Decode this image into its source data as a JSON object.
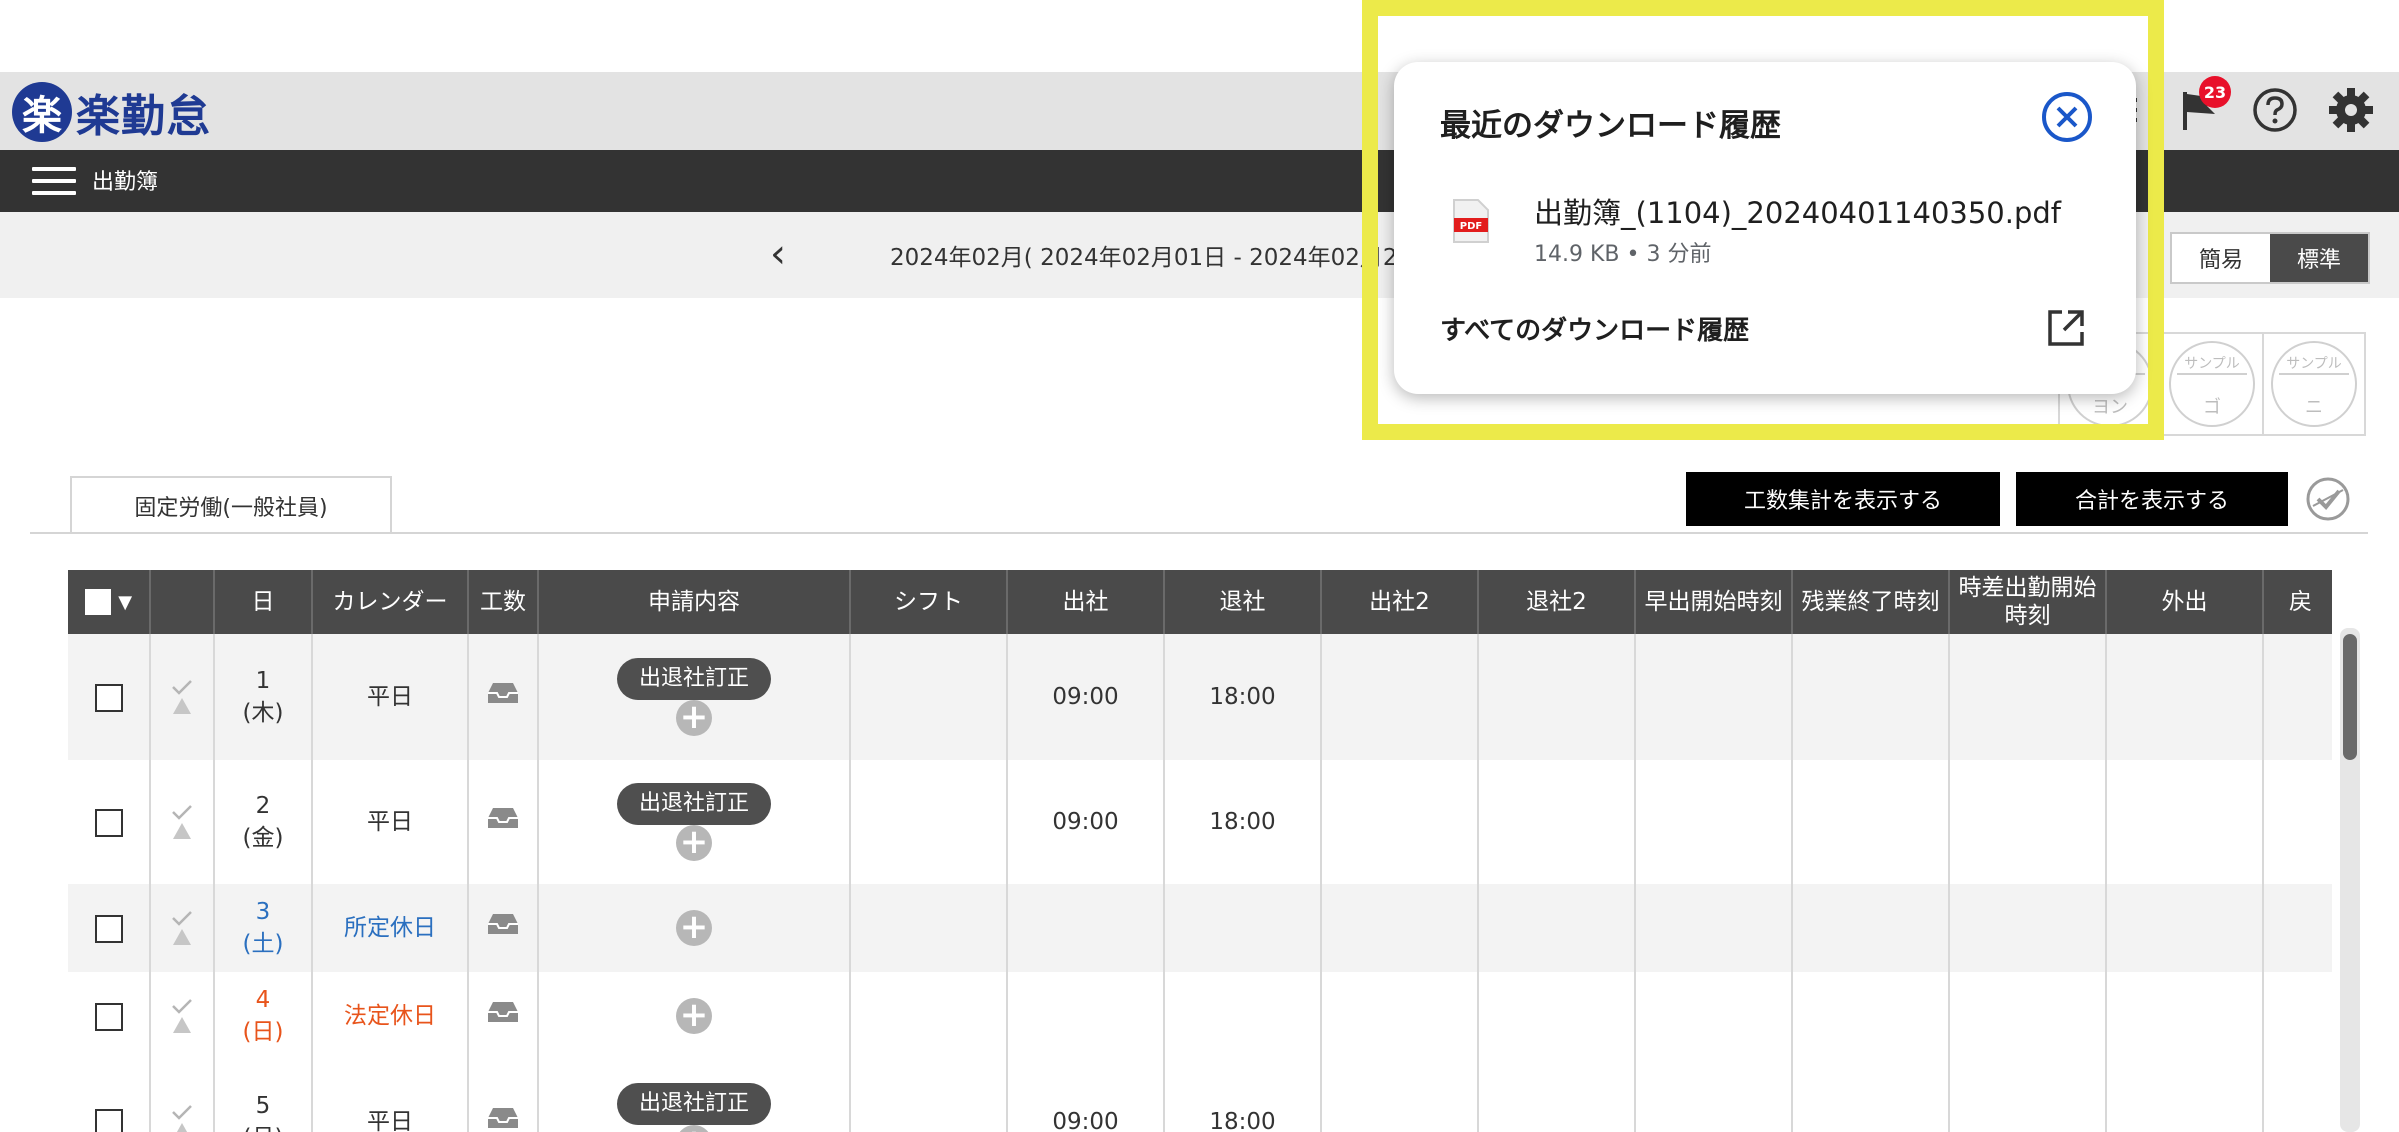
{
  "app": {
    "logo_mark": "楽",
    "logo_text": "楽勤怠",
    "notification_count": "23"
  },
  "nav": {
    "title": "出勤簿"
  },
  "period": {
    "text": "2024年02月( 2024年02月01日 - 2024年02月2",
    "view_simple": "簡易",
    "view_standard": "標準"
  },
  "stamps": [
    {
      "top": "",
      "bottom": "ヨン"
    },
    {
      "top": "サンプル",
      "bottom": "ゴ"
    },
    {
      "top": "サンプル",
      "bottom": "ニ"
    }
  ],
  "tab": {
    "label": "固定労働(一般社員)"
  },
  "buttons": {
    "man_hours": "工数集計を表示する",
    "totals": "合計を表示する"
  },
  "table": {
    "headers": {
      "check": "▼",
      "day": "日",
      "calendar": "カレンダー",
      "man_hours": "工数",
      "request": "申請内容",
      "shift": "シフト",
      "clock_in": "出社",
      "clock_out": "退社",
      "clock_in2": "出社2",
      "clock_out2": "退社2",
      "early_start": "早出開始時刻",
      "overtime_end": "残業終了時刻",
      "staggered_start": "時差出勤開始時刻",
      "outing": "外出",
      "return": "戻"
    },
    "rows": [
      {
        "day": "1",
        "dow": "(木)",
        "calendar": "平日",
        "request": "出退社訂正",
        "clock_in": "09:00",
        "clock_out": "18:00"
      },
      {
        "day": "2",
        "dow": "(金)",
        "calendar": "平日",
        "request": "出退社訂正",
        "clock_in": "09:00",
        "clock_out": "18:00"
      },
      {
        "day": "3",
        "dow": "(土)",
        "calendar": "所定休日",
        "request": "",
        "clock_in": "",
        "clock_out": ""
      },
      {
        "day": "4",
        "dow": "(日)",
        "calendar": "法定休日",
        "request": "",
        "clock_in": "",
        "clock_out": ""
      },
      {
        "day": "5",
        "dow": "(月)",
        "calendar": "平日",
        "request": "出退社訂正",
        "clock_in": "09:00",
        "clock_out": "18:00"
      }
    ]
  },
  "download_popup": {
    "title": "最近のダウンロード履歴",
    "file_name": "出勤簿_(1104)_20240401140350.pdf",
    "file_meta": "14.9 KB • 3 分前",
    "pdf_label": "PDF",
    "all_history": "すべてのダウンロード履歴"
  },
  "colors": {
    "brand": "#1f3a93",
    "highlight": "#ecea4a",
    "saturday": "#2a6fbf",
    "sunday": "#e8541b",
    "popup_close": "#1a57c9"
  }
}
